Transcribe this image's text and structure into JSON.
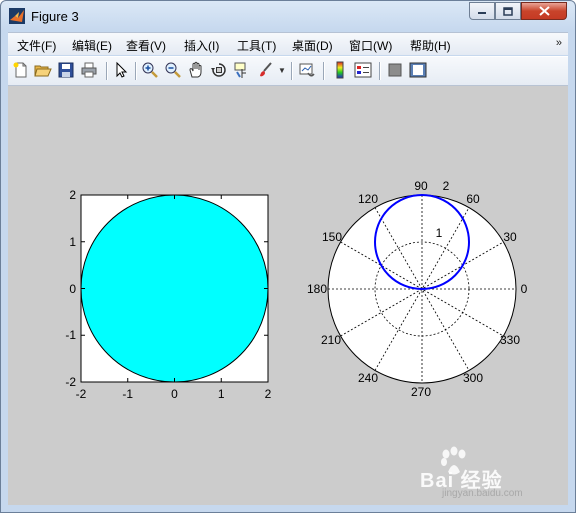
{
  "window": {
    "title": "Figure 3"
  },
  "menu": {
    "items": [
      "文件(F)",
      "编辑(E)",
      "查看(V)",
      "插入(I)",
      "工具(T)",
      "桌面(D)",
      "窗口(W)",
      "帮助(H)"
    ],
    "overflow_icon": "double-chevron-down-icon"
  },
  "toolbar": {
    "buttons": [
      "new-figure",
      "open-file",
      "save",
      "print",
      "edit-plot-arrow",
      "zoom-in",
      "zoom-out",
      "pan-hand",
      "rotate-3d",
      "data-cursor",
      "brush",
      "brush-dropdown",
      "link-plot",
      "insert-colorbar",
      "insert-legend",
      "hide-plot-tools",
      "show-plot-tools"
    ]
  },
  "axes1": {
    "x_ticks": [
      "-2",
      "-1",
      "0",
      "1",
      "2"
    ],
    "y_ticks": [
      "2",
      "1",
      "0",
      "-1",
      "-2"
    ],
    "fill_color": "#00ffff",
    "chart_data": {
      "type": "area",
      "shape": "filled circle",
      "center": [
        0,
        0
      ],
      "radius": 2,
      "xlim": [
        -2,
        2
      ],
      "ylim": [
        -2,
        2
      ]
    }
  },
  "axes2": {
    "angle_labels": [
      "0",
      "30",
      "60",
      "90",
      "120",
      "150",
      "180",
      "210",
      "240",
      "270",
      "300",
      "330"
    ],
    "radius_labels": [
      "1",
      "2"
    ],
    "line_color": "#0000ff",
    "chart_data": {
      "type": "line",
      "coordinates": "polar",
      "curve": "circle through origin, top point at r = 2, theta = 90",
      "rlim": [
        0,
        2
      ]
    }
  },
  "watermark": {
    "brand": "Bai 经验",
    "url": "jingyan.baidu.com"
  }
}
